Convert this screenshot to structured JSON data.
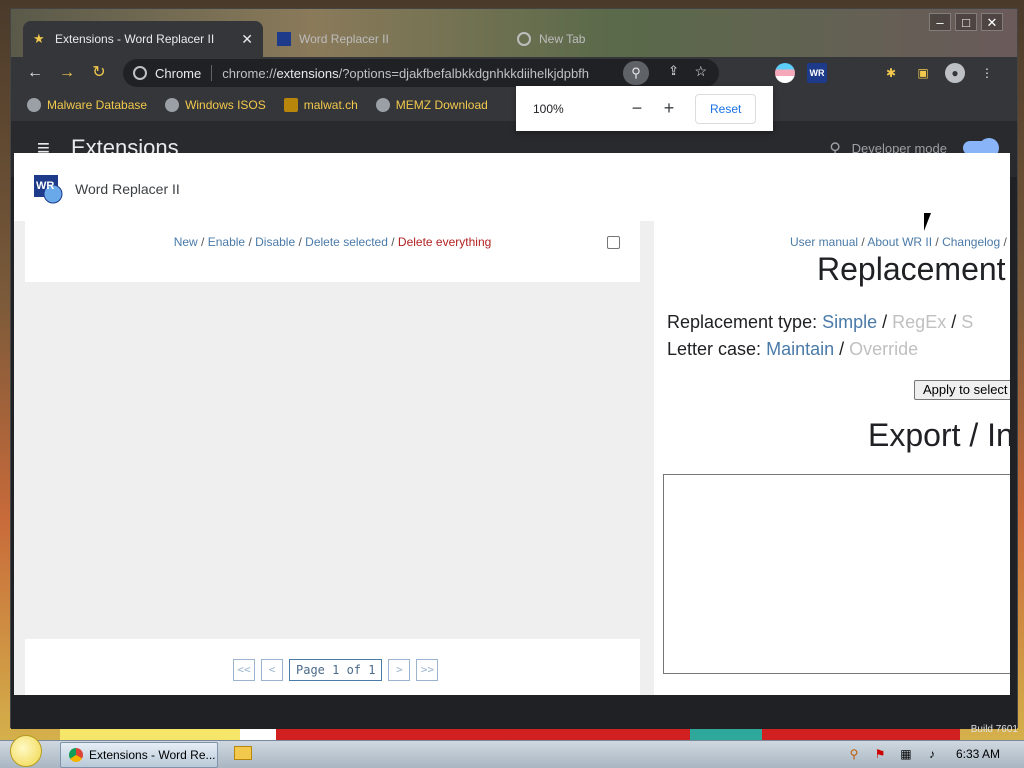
{
  "window": {
    "active_tab": "Extensions - Word Replacer II",
    "tabs": [
      {
        "label": "Extensions - Word Replacer II"
      },
      {
        "label": "Word Replacer II"
      },
      {
        "label": "New Tab"
      }
    ],
    "controls": {
      "minimize": "–",
      "maximize": "□",
      "close": "✕"
    }
  },
  "toolbar": {
    "back": "←",
    "forward": "→",
    "reload": "↻",
    "omnibox_label": "Chrome",
    "url_scheme": "chrome://",
    "url_host": "extensions",
    "url_rest": "/?options=djakfbefalbkkdgnhkkdiihelkjdpbfh",
    "wr_ext_label": "WR",
    "menu": "⋮"
  },
  "bookmarks": [
    {
      "label": "Malware Database"
    },
    {
      "label": "Windows ISOS"
    },
    {
      "label": "malwat.ch"
    },
    {
      "label": "MEMZ Download"
    }
  ],
  "extensions_page": {
    "title": "Extensions",
    "developer_mode": "Developer mode"
  },
  "zoom_popup": {
    "percent": "100%",
    "zoom_out": "−",
    "zoom_in": "+",
    "reset": "Reset"
  },
  "dialog": {
    "title": "Word Replacer II",
    "logo_text": "WR",
    "left": {
      "links": {
        "new": "New",
        "enable": "Enable",
        "disable": "Disable",
        "delete_selected": "Delete selected",
        "delete_everything": "Delete everything",
        "sep": " / "
      },
      "pager": {
        "first": "<<",
        "prev": "<",
        "page_text": "Page 1 of 1",
        "next": ">",
        "last": ">>"
      }
    },
    "right": {
      "links": {
        "user_manual": "User manual",
        "about": "About WR II",
        "changelog": "Changelog",
        "sep": " / "
      },
      "replacement_heading": "Replacement",
      "replacement_type_label": "Replacement type:",
      "type_simple": "Simple",
      "type_regex": "RegEx",
      "type_truncated": "S",
      "letter_case_label": "Letter case:",
      "case_maintain": "Maintain",
      "case_override": "Override",
      "apply_button": "Apply to select",
      "export_heading": "Export / In"
    }
  },
  "taskbar": {
    "task_label": "Extensions - Word Re...",
    "clock": "6:33 AM",
    "build": "Build 7601"
  }
}
